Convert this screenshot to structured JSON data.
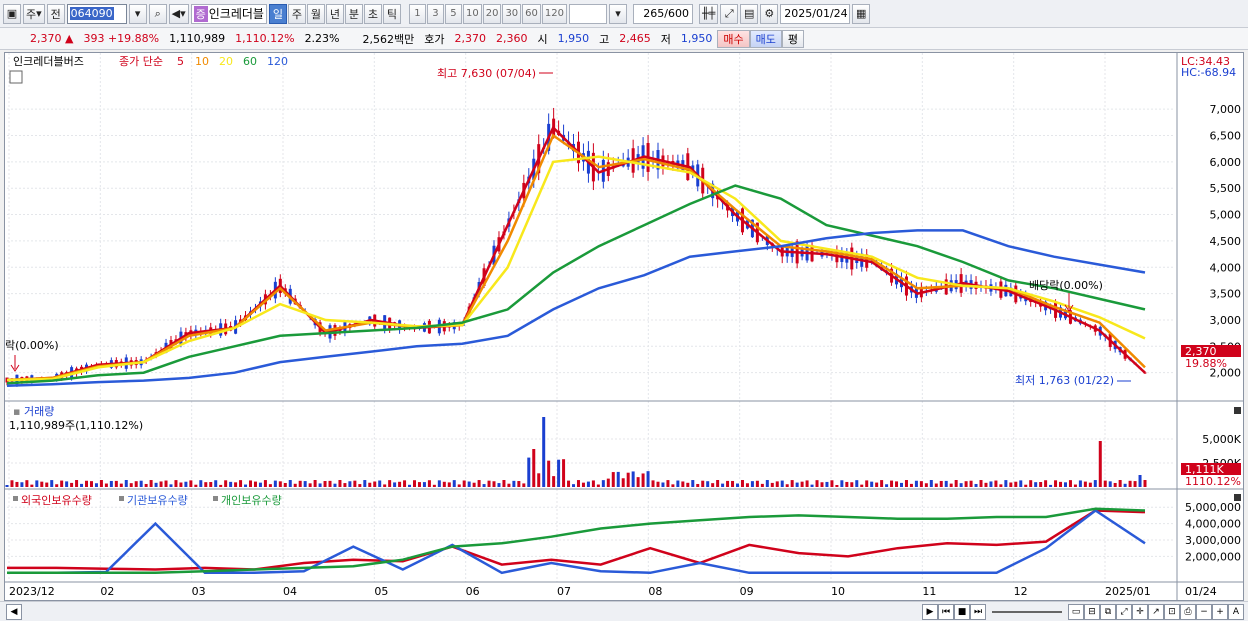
{
  "toolbar": {
    "market": "주",
    "prev_label": "전",
    "code": "064090",
    "badge": "증",
    "name": "인크레더블",
    "periods": [
      "일",
      "주",
      "월",
      "년",
      "분",
      "초",
      "틱"
    ],
    "intervals": [
      "1",
      "3",
      "5",
      "10",
      "20",
      "30",
      "60",
      "120"
    ],
    "count": "265",
    "count_max": "/600",
    "date": "2025/01/24"
  },
  "quote": {
    "price": "2,370",
    "change": "393",
    "change_pct": "+19.88%",
    "volume": "1,110,989",
    "volume_pct": "1,110.12%",
    "turnover_pct": "2.23%",
    "amount": "2,562백만",
    "bid_label": "호가",
    "ask": "2,370",
    "bid": "2,360",
    "open_label": "시",
    "open": "1,950",
    "high_label": "고",
    "high": "2,465",
    "low_label": "저",
    "low": "1,950",
    "buy_button": "매수",
    "sell_button": "매도",
    "eval_button": "평"
  },
  "price_pane": {
    "title": "인크레더블버즈",
    "ma_label": "종가 단순",
    "ma_periods": [
      "5",
      "10",
      "20",
      "60",
      "120"
    ],
    "ma_colors": [
      "#d0021b",
      "#f08a00",
      "#f8e81c",
      "#1a9a3a",
      "#2a5ad8",
      "#3a8ad8"
    ],
    "lc": "LC:34.43",
    "hc": "HC:-68.94",
    "high_annot": "최고 7,630 (07/04)",
    "low_annot": "최저 1,763 (01/22)",
    "left_annot": "락(0.00%)",
    "dividend_annot": "배당락(0.00%)",
    "current_price_tag": "2,370",
    "current_pct_tag": "19.88%",
    "y_ticks": [
      "7,000",
      "6,500",
      "6,000",
      "5,500",
      "5,000",
      "4,500",
      "4,000",
      "3,500",
      "3,000",
      "2,500",
      "2,000"
    ]
  },
  "volume_pane": {
    "title": "거래량",
    "value": "1,110,989주(1,110.12%)",
    "y_ticks": [
      "5,000K",
      "2,500K"
    ],
    "current_tag": "1,111K",
    "current_pct": "1110.12%"
  },
  "holding_pane": {
    "series": [
      "외국인보유수량",
      "기관보유수량",
      "개인보유수량"
    ],
    "series_colors": [
      "#d0021b",
      "#2a5ad8",
      "#1a9a3a"
    ],
    "y_ticks": [
      "5,000,000",
      "4,000,000",
      "3,000,000",
      "2,000,000"
    ]
  },
  "x_axis": {
    "labels": [
      "2023/12",
      "02",
      "03",
      "04",
      "05",
      "06",
      "07",
      "08",
      "09",
      "10",
      "11",
      "12",
      "2025/01",
      "01/24"
    ]
  },
  "chart_data": {
    "type": "line",
    "price_ylim": [
      1500,
      7800
    ],
    "ma_series": [
      {
        "name": "5",
        "values": [
          1860,
          1900,
          2150,
          2200,
          2750,
          2850,
          3650,
          2750,
          3000,
          2850,
          2900,
          4800,
          6650,
          5800,
          6100,
          5900,
          5000,
          4300,
          4250,
          4100,
          3500,
          3700,
          3550,
          3200,
          2800,
          2000
        ]
      },
      {
        "name": "10",
        "values": [
          1860,
          1900,
          2120,
          2200,
          2700,
          2850,
          3600,
          2800,
          2950,
          2860,
          2900,
          4500,
          6500,
          5900,
          6050,
          5850,
          5100,
          4400,
          4300,
          4150,
          3600,
          3650,
          3600,
          3250,
          2950,
          2100
        ]
      },
      {
        "name": "20",
        "values": [
          1860,
          1880,
          2100,
          2200,
          2600,
          2850,
          3300,
          3000,
          2950,
          2880,
          2900,
          4000,
          6000,
          6100,
          5950,
          5800,
          5300,
          4500,
          4350,
          4200,
          3800,
          3650,
          3600,
          3350,
          3050,
          2650
        ]
      },
      {
        "name": "60",
        "values": [
          1800,
          1850,
          1950,
          2000,
          2300,
          2500,
          2700,
          2750,
          2800,
          2850,
          2950,
          3200,
          3900,
          4400,
          4800,
          5200,
          5550,
          5300,
          4800,
          4600,
          4400,
          4100,
          3750,
          3600,
          3400,
          3200
        ]
      },
      {
        "name": "120",
        "values": [
          1750,
          1780,
          1820,
          1850,
          1900,
          2000,
          2200,
          2300,
          2400,
          2500,
          2550,
          2700,
          3200,
          3600,
          3850,
          4200,
          4300,
          4400,
          4550,
          4650,
          4700,
          4700,
          4400,
          4200,
          4050,
          3900
        ]
      }
    ],
    "holding_series": [
      {
        "name": "외국인보유수량",
        "values": [
          1300000,
          1300000,
          1250000,
          1200000,
          1300000,
          1200000,
          1600000,
          1800000,
          1700000,
          2600000,
          1500000,
          1800000,
          1500000,
          2500000,
          1600000,
          2700000,
          2200000,
          2000000,
          2500000,
          2800000,
          2700000,
          2900000,
          4800000,
          4700000
        ]
      },
      {
        "name": "기관보유수량",
        "values": [
          1000000,
          1000000,
          1050000,
          4000000,
          1000000,
          1000000,
          1100000,
          2600000,
          1200000,
          2700000,
          1000000,
          1600000,
          1100000,
          1000000,
          1600000,
          1000000,
          1000000,
          1000000,
          1000000,
          1000000,
          1000000,
          2500000,
          4800000,
          2800000
        ]
      },
      {
        "name": "개인보유수량",
        "values": [
          1000000,
          1000000,
          1000000,
          1000000,
          1100000,
          1200000,
          1300000,
          1400000,
          1800000,
          2600000,
          2800000,
          3200000,
          3700000,
          4000000,
          4200000,
          4400000,
          4500000,
          4400000,
          4300000,
          4300000,
          4400000,
          4400000,
          4900000,
          4800000
        ]
      }
    ]
  }
}
